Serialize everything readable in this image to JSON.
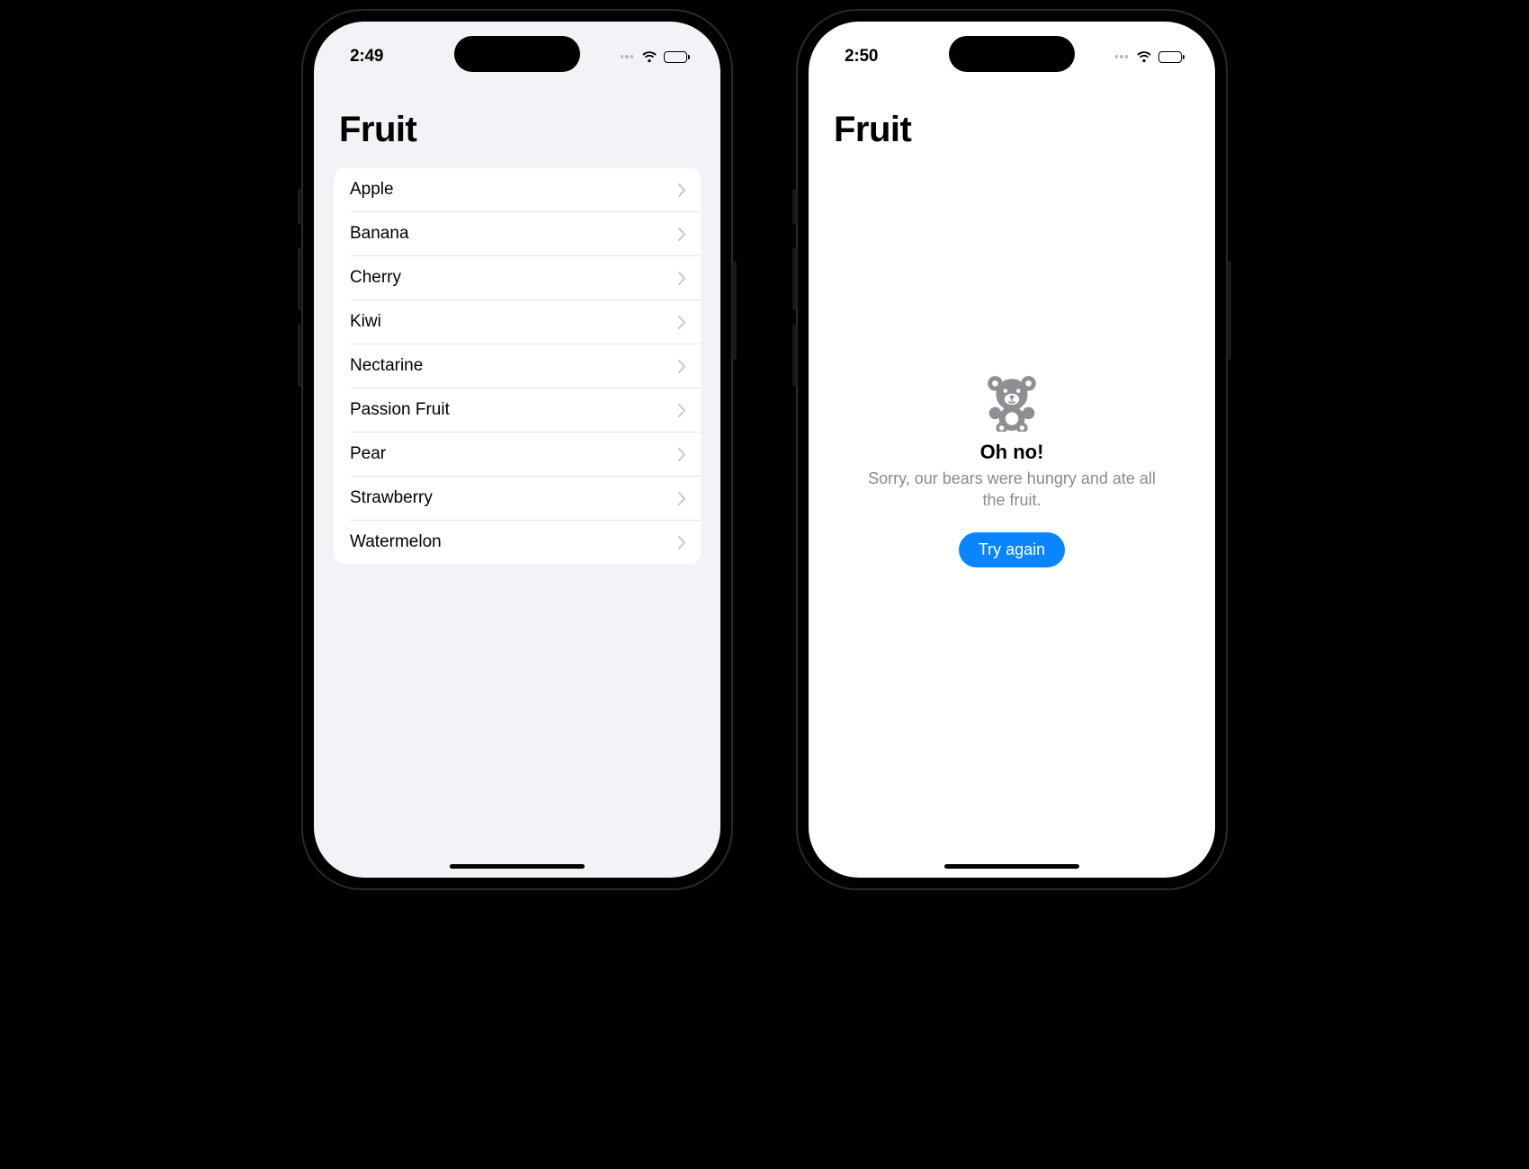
{
  "left": {
    "status": {
      "time": "2:49"
    },
    "title": "Fruit",
    "list": [
      {
        "label": "Apple"
      },
      {
        "label": "Banana"
      },
      {
        "label": "Cherry"
      },
      {
        "label": "Kiwi"
      },
      {
        "label": "Nectarine"
      },
      {
        "label": "Passion Fruit"
      },
      {
        "label": "Pear"
      },
      {
        "label": "Strawberry"
      },
      {
        "label": "Watermelon"
      }
    ]
  },
  "right": {
    "status": {
      "time": "2:50"
    },
    "title": "Fruit",
    "empty": {
      "heading": "Oh no!",
      "description": "Sorry, our bears were hungry and ate all the fruit.",
      "button": "Try again"
    }
  },
  "colors": {
    "accent": "#0a84ff",
    "secondary_text": "#8a8a8f",
    "list_bg": "#f2f2f7",
    "separator": "#e5e5ea"
  }
}
